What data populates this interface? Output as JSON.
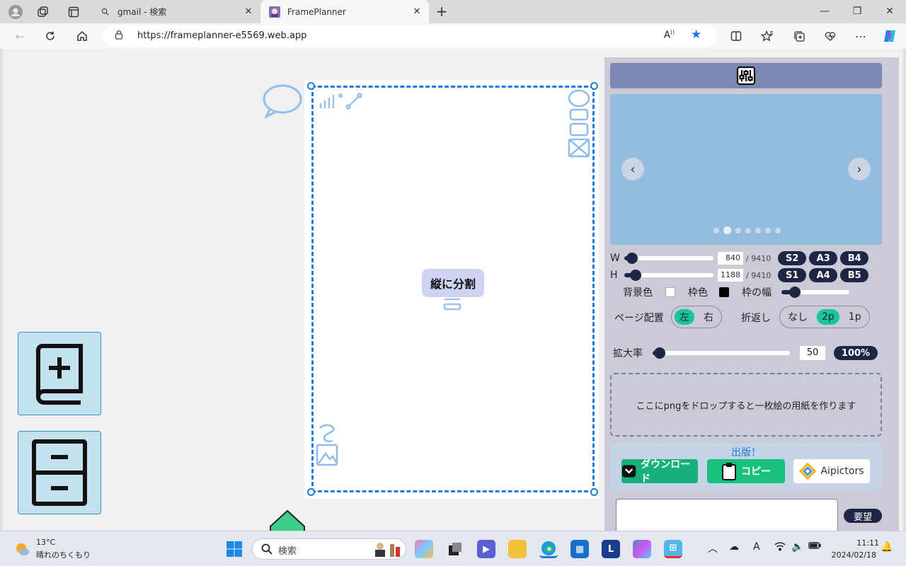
{
  "browser": {
    "tabs": [
      {
        "label": "gmail - 検索"
      },
      {
        "label": "FramePlanner"
      }
    ],
    "url": "https://frameplanner-e5569.web.app"
  },
  "canvas": {
    "split_label": "縦に分割"
  },
  "panel": {
    "w_label": "W",
    "w_value": "840",
    "w_max": "/ 9410",
    "h_label": "H",
    "h_value": "1188",
    "h_max": "/ 9410",
    "w_fraction": 0.09,
    "h_fraction": 0.13,
    "size_presets_row1": [
      "S2",
      "A3",
      "B4"
    ],
    "size_presets_row2": [
      "S1",
      "A4",
      "B5"
    ],
    "bg_color_label": "背景色",
    "frame_color_label": "枠色",
    "frame_width_label": "枠の幅",
    "bg_color": "#ffffff",
    "frame_color": "#000000",
    "frame_width_fraction": 0.2,
    "page_layout_label": "ページ配置",
    "page_layout_options": [
      "左",
      "右"
    ],
    "page_layout_selected": "左",
    "wrap_label": "折返し",
    "wrap_options": [
      "なし",
      "2p",
      "1p"
    ],
    "wrap_selected": "2p",
    "zoom_label": "拡大率",
    "zoom_value": "50",
    "zoom_fraction": 0.05,
    "zoom_reset": "100%",
    "drop_text": "ここにpngをドロップすると一枚絵の用紙を作ります",
    "publish_title": "出版！",
    "download_label": "ダウンロード",
    "copy_label": "コピー",
    "aipictors_label": "Aipictors",
    "request_label": "要望",
    "carousel_dots": 7,
    "carousel_active_dot": 1
  },
  "taskbar": {
    "weather_temp": "13°C",
    "weather_desc": "晴れのちくもり",
    "search_placeholder": "検索",
    "time": "11:11",
    "date": "2024/02/18",
    "ime_indicator": "A"
  },
  "colors": {
    "accent_blue": "#1e7be0",
    "panel_dark": "#1f2545",
    "toggle_on": "#18c49a",
    "download_green": "#18b07a"
  }
}
